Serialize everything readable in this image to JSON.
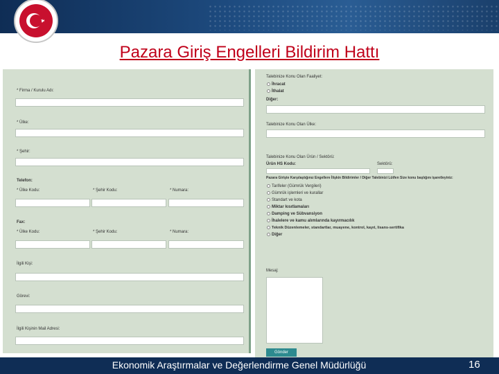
{
  "title": "Pazara Giriş Engelleri Bildirim Hattı",
  "left_form": {
    "firma_label": "* Firma / Kurulu Adı:",
    "ulke_label": "* Ülke:",
    "sehir_label": "* Şehir:",
    "telefon_label": "Telefon:",
    "tel_ulke_kodu": "* Ülke Kodu:",
    "tel_sehir_kodu": "* Şehir Kodu:",
    "tel_numara": "* Numara:",
    "fax_label": "Fax:",
    "fax_ulke_kodu": "* Ülke Kodu:",
    "fax_sehir_kodu": "* Şehir Kodu:",
    "fax_numara": "* Numara:",
    "ilgili_kisi_label": "İlgili Kişi:",
    "gorevi_label": "Görevi:",
    "mail_label": "İlgili Kişinin Mail Adresi:"
  },
  "right_form": {
    "talep_konu_label": "Talebinize Konu Olan Faaliyet:",
    "ihracat": "İhracat",
    "ithalat": "İthalat",
    "diger_label": "Diğer:",
    "talep_ulke_label": "Talebinize Konu Olan Ülke:",
    "urun_label": "Talebinize Konu Olan Ürün / Sektörü:",
    "gtip_label": "Ürün HS Kodu:",
    "sektor_label": "Sektörü:",
    "engel_label": "Pazara Girişte Karşılaştığınız Engellere İlişkin Bildirimler / Diğer Talebinizi Lütfen Size konu başlığını işaretleyiniz:",
    "options": [
      "Tarifeler (Gümrük Vergileri)",
      "Gümrük işlemleri ve kurallar",
      "Standart ve kota",
      "Miktar kısıtlamaları",
      "Damping ve Sübvansiyon",
      "İhalelere ve kamu alımlarında kayırmacılık",
      "Teknik Düzenlemeler, standartlar, muayene, kontrol, kayıt, lisans-sertifika",
      "Diğer"
    ],
    "mesaj_label": "Mesaj:",
    "submit": "Gönder"
  },
  "footer": {
    "text": "Ekonomik Araştırmalar ve Değerlendirme Genel Müdürlüğü",
    "page_number": "16"
  },
  "colors": {
    "header_bg": "#0f2d55",
    "title_red": "#c0001a",
    "form_bg": "#d4dfd0",
    "button": "#2d8a8f"
  }
}
